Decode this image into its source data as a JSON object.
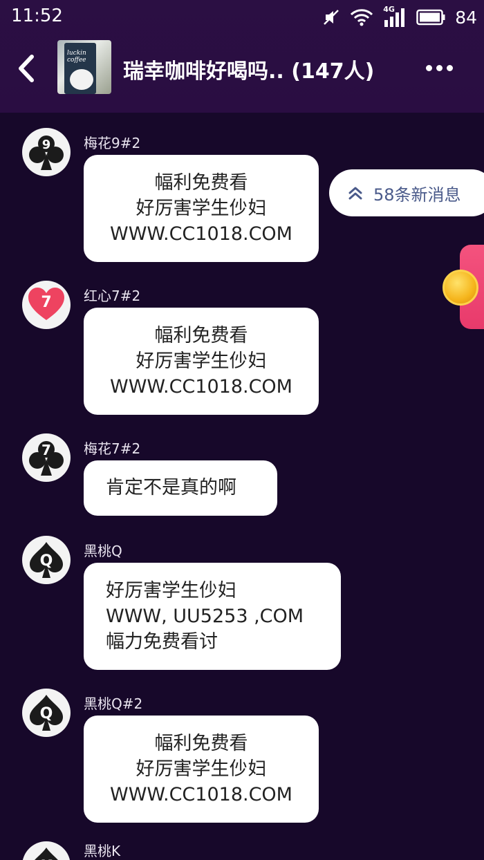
{
  "status": {
    "time": "11:52",
    "network": "4G",
    "battery": "84"
  },
  "header": {
    "title": "瑞幸咖啡好喝吗.. (147人)",
    "avatar_text": "luckin coffee"
  },
  "new_messages": {
    "label": "58条新消息"
  },
  "messages": [
    {
      "nick": "梅花9#2",
      "avatar_label": "9",
      "avatar_suit": "club",
      "lines": [
        "幅利免费看",
        "好厉害学生仯妇",
        "WWW.CC1018.COM"
      ]
    },
    {
      "nick": "红心7#2",
      "avatar_label": "7",
      "avatar_suit": "heart",
      "lines": [
        "幅利免费看",
        "好厉害学生仯妇",
        "WWW.CC1018.COM"
      ]
    },
    {
      "nick": "梅花7#2",
      "avatar_label": "7",
      "avatar_suit": "club",
      "lines": [
        "肯定不是真的啊"
      ]
    },
    {
      "nick": "黑桃Q",
      "avatar_label": "Q",
      "avatar_suit": "spade",
      "lines": [
        "好厉害学生仯妇",
        "WWW, UU5253 ,COM",
        "幅力免费看讨"
      ]
    },
    {
      "nick": "黑桃Q#2",
      "avatar_label": "Q",
      "avatar_suit": "spade",
      "lines": [
        "幅利免费看",
        "好厉害学生仯妇",
        "WWW.CC1018.COM"
      ]
    },
    {
      "nick": "黑桃K",
      "avatar_label": "K",
      "avatar_suit": "spade",
      "lines": []
    }
  ]
}
